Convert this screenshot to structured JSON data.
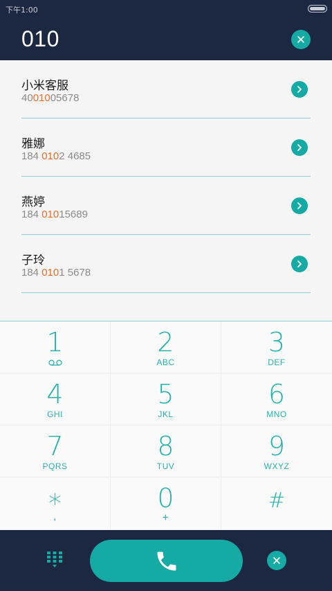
{
  "status_bar": {
    "time": "下午1:00"
  },
  "dialer": {
    "input": "010"
  },
  "contacts": [
    {
      "name": "小米客服",
      "number_pre": "40",
      "number_match": "010",
      "number_post": "05678"
    },
    {
      "name": "雅娜",
      "number_pre": "184 ",
      "number_match": "010",
      "number_post": "2 4685"
    },
    {
      "name": "燕婷",
      "number_pre": "184 ",
      "number_match": "010",
      "number_post": "15689"
    },
    {
      "name": "子玲",
      "number_pre": "184 ",
      "number_match": "010",
      "number_post": "1 5678"
    }
  ],
  "keypad": [
    {
      "digit": "1",
      "letters": ""
    },
    {
      "digit": "2",
      "letters": "ABC"
    },
    {
      "digit": "3",
      "letters": "DEF"
    },
    {
      "digit": "4",
      "letters": "GHI"
    },
    {
      "digit": "5",
      "letters": "JKL"
    },
    {
      "digit": "6",
      "letters": "MNO"
    },
    {
      "digit": "7",
      "letters": "PQRS"
    },
    {
      "digit": "8",
      "letters": "TUV"
    },
    {
      "digit": "9",
      "letters": "WXYZ"
    },
    {
      "digit": "*",
      "letters": ","
    },
    {
      "digit": "0",
      "letters": "+"
    },
    {
      "digit": "#",
      "letters": ""
    }
  ],
  "colors": {
    "header_bg": "#1c2841",
    "accent": "#16aaa5",
    "highlight": "#ee6d27",
    "divider": "#8fd3d1"
  },
  "icons": {
    "clear": "close-icon",
    "contact_action": "chevron-right-icon",
    "voicemail": "voicemail-icon",
    "dialpad": "dialpad-icon",
    "call": "phone-icon",
    "delete": "close-icon"
  }
}
